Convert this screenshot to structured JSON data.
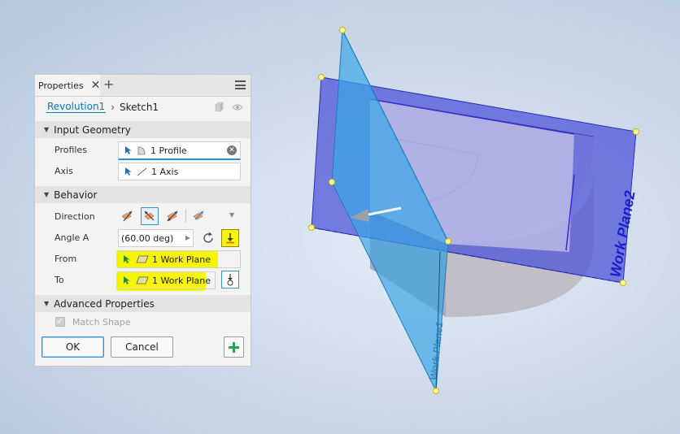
{
  "colors": {
    "panel_bg": "#f3f3f3",
    "section_bg": "#e3e3e3",
    "link_blue": "#0a7ab8",
    "highlight_yellow": "#f6f600",
    "workplane1_fill": "#3aa6e6",
    "workplane2_fill": "#4a50d8",
    "plus_green": "#2aa44a"
  },
  "panel": {
    "tab_label": "Properties",
    "breadcrumb": {
      "parent": "Revolution1",
      "current": "Sketch1"
    },
    "sections": {
      "input_geometry": "Input Geometry",
      "behavior": "Behavior",
      "advanced": "Advanced Properties"
    },
    "profiles": {
      "label": "Profiles",
      "value": "1 Profile"
    },
    "axis": {
      "label": "Axis",
      "value": "1 Axis"
    },
    "direction": {
      "label": "Direction"
    },
    "angle": {
      "label": "Angle A",
      "value": "(60.00 deg)"
    },
    "from": {
      "label": "From",
      "value": "1 Work Plane"
    },
    "to": {
      "label": "To",
      "value": "1 Work Plane"
    },
    "match_shape": {
      "label": "Match Shape",
      "checked": true
    },
    "buttons": {
      "ok": "OK",
      "cancel": "Cancel"
    }
  },
  "viewport": {
    "workplane2_label": "Work Plane2",
    "workplane1_label": "Work Plane1"
  }
}
